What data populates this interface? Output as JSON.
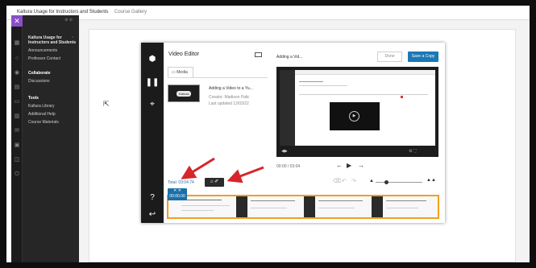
{
  "topbar": {
    "course_name": "Kaltura Usage for Instructors and Students",
    "crumb": "Course Gallery"
  },
  "sidebar": {
    "course_heading": "Kaltura Usage for Instructors and Students",
    "items": [
      {
        "label": "Announcements"
      },
      {
        "label": "Professor Contact"
      }
    ],
    "section_collaborate": "Collaborate",
    "collab_items": [
      {
        "label": "Discussions"
      }
    ],
    "section_tools": "Tools",
    "tool_items": [
      {
        "label": "Kaltura Library"
      },
      {
        "label": "Additional Help"
      },
      {
        "label": "Course Materials"
      }
    ]
  },
  "editor": {
    "title": "Video Editor",
    "tab_media": "Media",
    "media_item": {
      "name": "Adding a Video to a Yu...",
      "creator": "Creator: Madison Palic",
      "updated": "Last updated 12/03/22",
      "thumb_label": "Kaltura"
    },
    "preview_title": "Adding a Vid...",
    "done_label": "Done",
    "save_copy_label": "Save a Copy",
    "timecode": "00:00 / 03:04",
    "total_time": "Total: 03:04.74",
    "playhead_time": "00:00.00",
    "icons": {
      "rail": [
        "cube-icon",
        "pause-icon",
        "cursor-icon",
        "help-icon",
        "back-icon"
      ]
    }
  },
  "colors": {
    "accent": "#1a78b4",
    "timeline_border": "#f0a020",
    "arrow": "#d6262b",
    "sidebar_bg": "#262626",
    "kaltura_purple": "#8a4fc9"
  }
}
